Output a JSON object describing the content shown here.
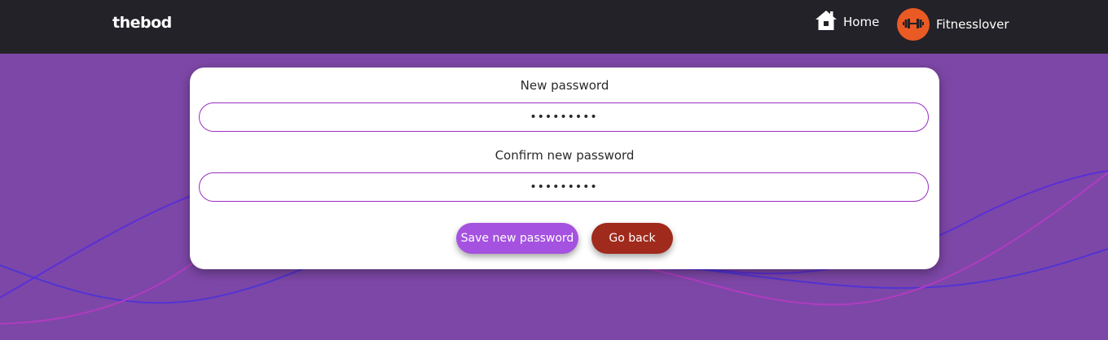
{
  "navbar": {
    "brand": "thebod",
    "home_label": "Home",
    "username": "Fitnesslover"
  },
  "form": {
    "new_password_label": "New password",
    "new_password_value": "•••••••••",
    "confirm_password_label": "Confirm new password",
    "confirm_password_value": "•••••••••",
    "save_label": "Save new password",
    "back_label": "Go back"
  },
  "colors": {
    "navbar_bg": "#232228",
    "page_bg": "#7d47a7",
    "avatar_bg": "#ea5a24",
    "save_button": "#a552e0",
    "back_button": "#a02a1c",
    "input_border": "#9b2fc4"
  },
  "icons": {
    "home": "home-icon",
    "avatar": "dumbbell-icon"
  }
}
